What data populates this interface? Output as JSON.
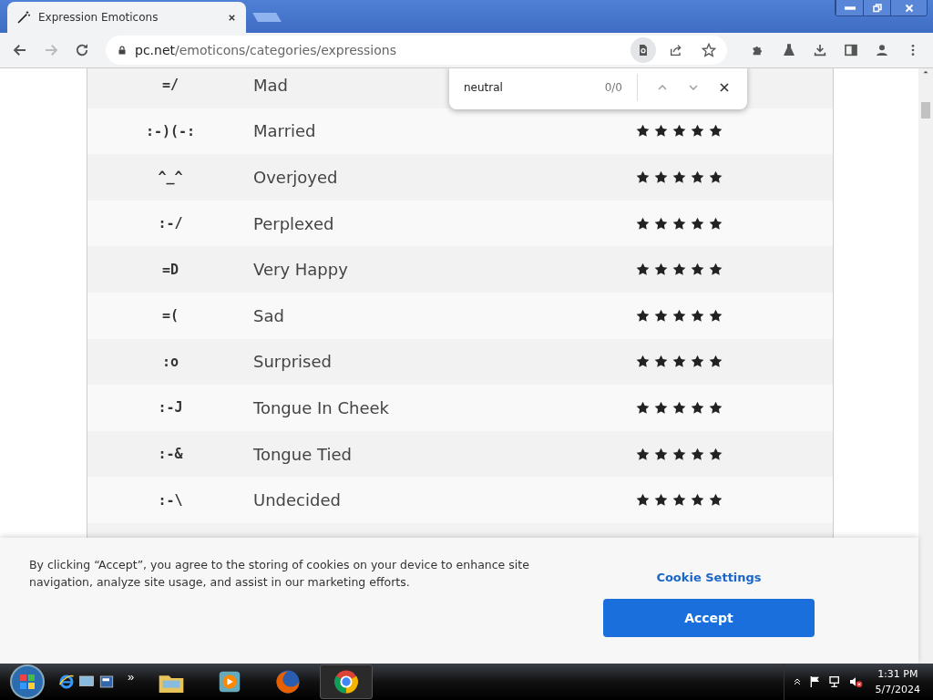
{
  "browser": {
    "tab_title": "Expression Emoticons",
    "url_host": "pc.net",
    "url_path": "/emoticons/categories/expressions"
  },
  "find_bar": {
    "query": "neutral",
    "count": "0/0"
  },
  "table": {
    "rows": [
      {
        "emoticon": "=/",
        "name": "Mad"
      },
      {
        "emoticon": ":-)(-:",
        "name": "Married",
        "stars": 5
      },
      {
        "emoticon": "^_^",
        "name": "Overjoyed",
        "stars": 5
      },
      {
        "emoticon": ":-/",
        "name": "Perplexed",
        "stars": 5
      },
      {
        "emoticon": "=D",
        "name": "Very Happy",
        "stars": 5
      },
      {
        "emoticon": "=(",
        "name": "Sad",
        "stars": 5
      },
      {
        "emoticon": ":o",
        "name": "Surprised",
        "stars": 5
      },
      {
        "emoticon": ":-J",
        "name": "Tongue In Cheek",
        "stars": 5
      },
      {
        "emoticon": ":-&",
        "name": "Tongue Tied",
        "stars": 5
      },
      {
        "emoticon": ":-\\",
        "name": "Undecided",
        "stars": 5
      }
    ]
  },
  "cookie_banner": {
    "text": "By clicking “Accept”, you agree to the storing of cookies on your device to enhance site navigation, analyze site usage, and assist in our marketing efforts.",
    "settings_link": "Cookie Settings",
    "accept_button": "Accept"
  },
  "taskbar": {
    "overflow": "»",
    "time": "1:31 PM",
    "date": "5/7/2024"
  }
}
